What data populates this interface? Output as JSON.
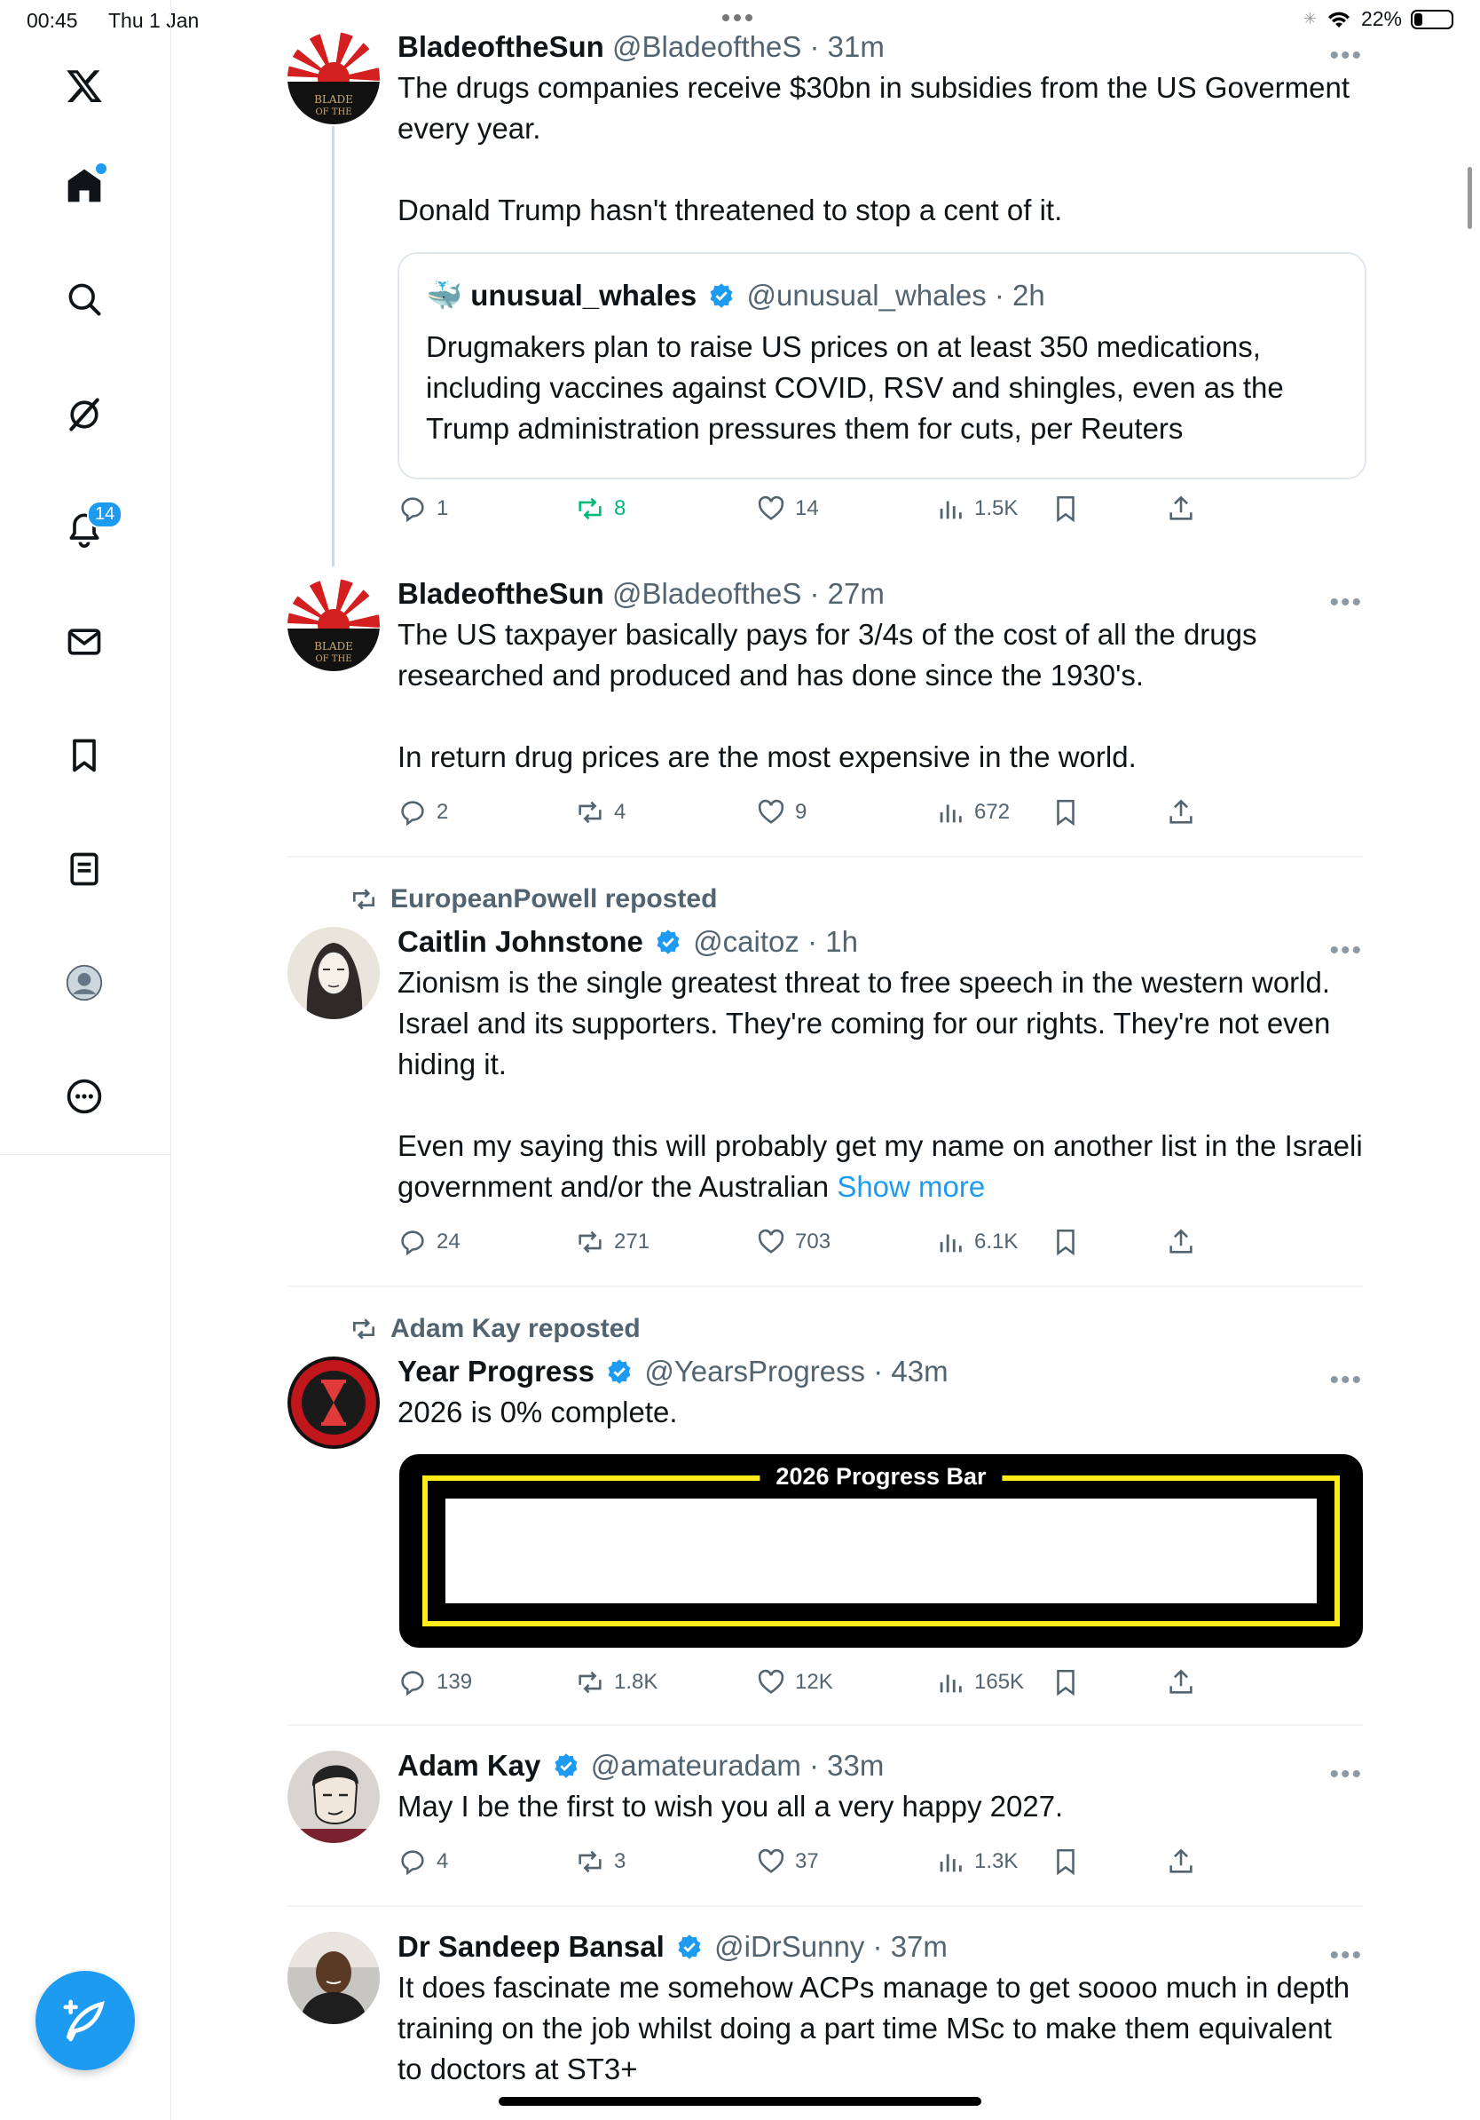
{
  "status_bar": {
    "time": "00:45",
    "date": "Thu 1 Jan",
    "battery": "22%",
    "battery_level": 0.22
  },
  "sidebar": {
    "notifications_badge": "14"
  },
  "tweets": [
    {
      "name": "BladeoftheSun",
      "handle": "@BladeoftheS",
      "time": "31m",
      "text": "The drugs companies receive $30bn in subsidies from the US Goverment every year.\n\nDonald Trump hasn't threatened to stop a cent of it.",
      "quote": {
        "name": "unusual_whales",
        "handle": "@unusual_whales",
        "time": "2h",
        "text": "Drugmakers plan to raise US prices on at least 350 medications, including vaccines against COVID, RSV and shingles, even as the Trump administration pressures them for cuts, per Reuters"
      },
      "replies": "1",
      "reposts": "8",
      "likes": "14",
      "views": "1.5K"
    },
    {
      "name": "BladeoftheSun",
      "handle": "@BladeoftheS",
      "time": "27m",
      "text": "The US taxpayer basically pays for 3/4s of the cost of all the drugs researched and produced and has done since the 1930's.\n\nIn return drug prices are the most expensive in the world.",
      "replies": "2",
      "reposts": "4",
      "likes": "9",
      "views": "672"
    },
    {
      "reposted_by": "EuropeanPowell reposted",
      "name": "Caitlin Johnstone",
      "handle": "@caitoz",
      "time": "1h",
      "text": "Zionism is the single greatest threat to free speech in the western world. Israel and its supporters. They're coming for our rights. They're not even hiding it.\n\nEven my saying this will probably get my name on another list in the Israeli government and/or the Australian ",
      "show_more": "Show more",
      "replies": "24",
      "reposts": "271",
      "likes": "703",
      "views": "6.1K"
    },
    {
      "reposted_by": "Adam Kay reposted",
      "name": "Year Progress",
      "handle": "@YearsProgress",
      "time": "43m",
      "text": "2026 is 0% complete.",
      "card_title": "2026 Progress Bar",
      "progress": 0,
      "replies": "139",
      "reposts": "1.8K",
      "likes": "12K",
      "views": "165K"
    },
    {
      "name": "Adam Kay",
      "handle": "@amateuradam",
      "time": "33m",
      "text": "May I be the first to wish you all a very happy 2027.",
      "replies": "4",
      "reposts": "3",
      "likes": "37",
      "views": "1.3K"
    },
    {
      "name": "Dr Sandeep Bansal",
      "handle": "@iDrSunny",
      "time": "37m",
      "text": "It does fascinate me somehow ACPs manage to get soooo much in depth training on the job whilst doing a part time MSc to make them equivalent to doctors at ST3+"
    }
  ],
  "colors": {
    "accent": "#1d9bf0",
    "repost_green": "#00ba7c",
    "muted": "#536471"
  }
}
